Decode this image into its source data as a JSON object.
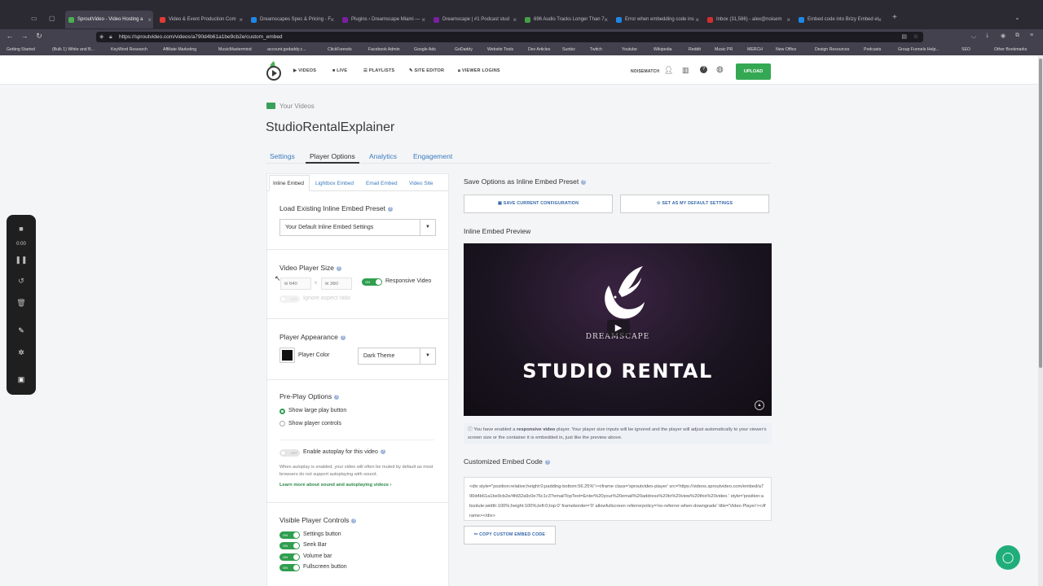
{
  "browser": {
    "tabs": [
      {
        "title": "SproutVideo - Video Hosting a",
        "color": "#4caf50"
      },
      {
        "title": "Video & Event Production Com",
        "color": "#e53935"
      },
      {
        "title": "Dreamscapes Spec & Pricing - F",
        "color": "#1e88e5"
      },
      {
        "title": "Plugins ‹ Dreamscape Miami —",
        "color": "#7b1fa2"
      },
      {
        "title": "Dreamscape | #1 Podcast stud",
        "color": "#7b1fa2"
      },
      {
        "title": "696 Audio Tracks Longer Than 7",
        "color": "#43a047"
      },
      {
        "title": "Error when embedding code ins",
        "color": "#1e88e5"
      },
      {
        "title": "Inbox (31,586) - alex@noisem",
        "color": "#d32f2f"
      },
      {
        "title": "Embed code into Brizy Embed el",
        "color": "#1e88e5"
      }
    ],
    "url": "https://sproutvideo.com/videos/a790d4b61a1be9cb2e/custom_embed",
    "bookmarks": [
      "Getting Started",
      "(Bulk 1) White and B...",
      "KeyWord Research",
      "Affiliate Marketing",
      "MusicMastermind",
      "account.godaddy.c...",
      "ClickFunnels",
      "Facebook Admin",
      "Google Ads",
      "GoDaddy",
      "Website Tools",
      "Dev Articles",
      "Sunbiz",
      "Twitch",
      "Youtube",
      "Wikipedia",
      "Reddit",
      "Music PR",
      "MERCH",
      "New Office",
      "Design Resources",
      "Podcasts",
      "Group Funnels Help...",
      "SEO",
      "Other Bookmarks"
    ]
  },
  "header": {
    "nav": [
      "VIDEOS",
      "LIVE",
      "PLAYLISTS",
      "SITE EDITOR",
      "VIEWER LOGINS"
    ],
    "account": "NOISEMATCH",
    "upload": "UPLOAD"
  },
  "recorder": {
    "time": "0:00"
  },
  "page": {
    "breadcrumb": "Your Videos",
    "title": "StudioRentalExplainer",
    "tabs": [
      "Settings",
      "Player Options",
      "Analytics",
      "Engagement"
    ],
    "active_tab": "Player Options",
    "subtabs": [
      "Inline Embed",
      "Lightbox Embed",
      "Email Embed",
      "Video Site"
    ]
  },
  "left": {
    "preset_title": "Load Existing Inline Embed Preset",
    "preset_value": "Your Default Inline Embed Settings",
    "size_title": "Video Player Size",
    "width_placeholder": "w 640",
    "height_placeholder": "w 360",
    "x": "x",
    "responsive_label": "Responsive Video",
    "on": "ON",
    "off": "OFF",
    "ignore_label": "Ignore aspect ratio",
    "appearance_title": "Player Appearance",
    "player_color_label": "Player Color",
    "player_color": "#111111",
    "theme_value": "Dark Theme",
    "preplay_title": "Pre-Play Options",
    "preplay_opt1": "Show large play button",
    "preplay_opt2": "Show player controls",
    "autoplay_label": "Enable autoplay for this video",
    "autoplay_note": "When autoplay is enabled, your video will often be muted by default as most browsers do not support autoplaying with sound.",
    "autoplay_link": "Learn more about sound and autoplaying videos ›",
    "controls_title": "Visible Player Controls",
    "controls": [
      "Settings button",
      "Seek Bar",
      "Volume bar",
      "Fullscreen button"
    ]
  },
  "right": {
    "save_title": "Save Options as Inline Embed Preset",
    "save_btn": "SAVE CURRENT CONFIGURATION",
    "default_btn": "SET AS MY DEFAULT SETTINGS",
    "preview_title": "Inline Embed Preview",
    "logo_text": "DREAMSCAPE",
    "video_title": "STUDIO RENTAL",
    "note_prefix": "You have enabled a ",
    "note_bold": "responsive video",
    "note_rest": " player. Your player size inputs will be ignored and the player will adjust automatically to your viewer's screen size or the container it is embedded in, just like the preview above.",
    "code_title": "Customized Embed Code",
    "code": "<div style=\"position:relative;height:0;padding-bottom:56.25%\"><iframe class='sproutvideo-player' src='https://videos.sproutvideo.com/embed/a790d4b61a1be9cb2e/4fd32a9c0e76c1c3?emailTopText=Enter%20your%20email%20address%20to%20view%20this%20video.' style='position:absolute;width:100%;height:100%;left:0;top:0' frameborder='0' allowfullscreen referrerpolicy='no-referrer-when-downgrade' title='Video Player'></iframe></div>",
    "copy_btn": "COPY CUSTOM EMBED CODE"
  }
}
